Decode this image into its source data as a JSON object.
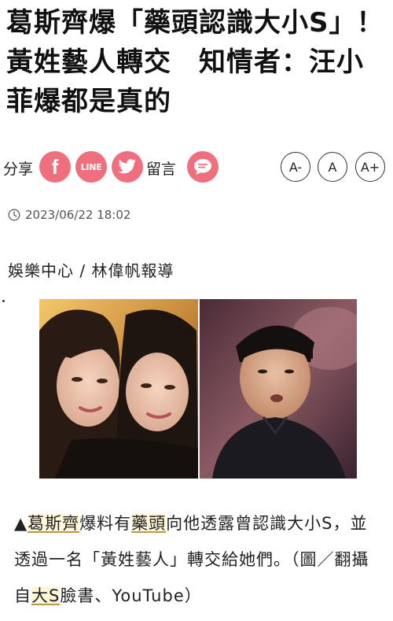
{
  "article": {
    "headline": "葛斯齊爆「藥頭認識大小S」！黃姓藝人轉交　知情者：汪小菲爆都是真的",
    "date": "2023/06/22 18:02",
    "byline": "娛樂中心 / 林偉帆報導"
  },
  "share": {
    "share_label": "分享",
    "facebook_glyph": "f",
    "line_label": "LINE",
    "comment_label": "留言"
  },
  "font_controls": {
    "decrease": "A-",
    "reset": "A",
    "increase": "A+"
  },
  "caption": {
    "prefix": "▲",
    "link1": "葛斯齊",
    "text1": "爆料有",
    "link2": "藥頭",
    "text2": "向他透露曾認識大小S，並透過一名「黃姓藝人」轉交給她們。（圖／翻攝自",
    "link3": "大S",
    "text3": "臉書、YouTube）"
  },
  "colors": {
    "share_circle": "#ef6f7e",
    "text": "#111111",
    "meta": "#555555"
  },
  "icons": [
    "facebook-icon",
    "line-icon",
    "twitter-icon",
    "comment-icon",
    "clock-icon"
  ]
}
